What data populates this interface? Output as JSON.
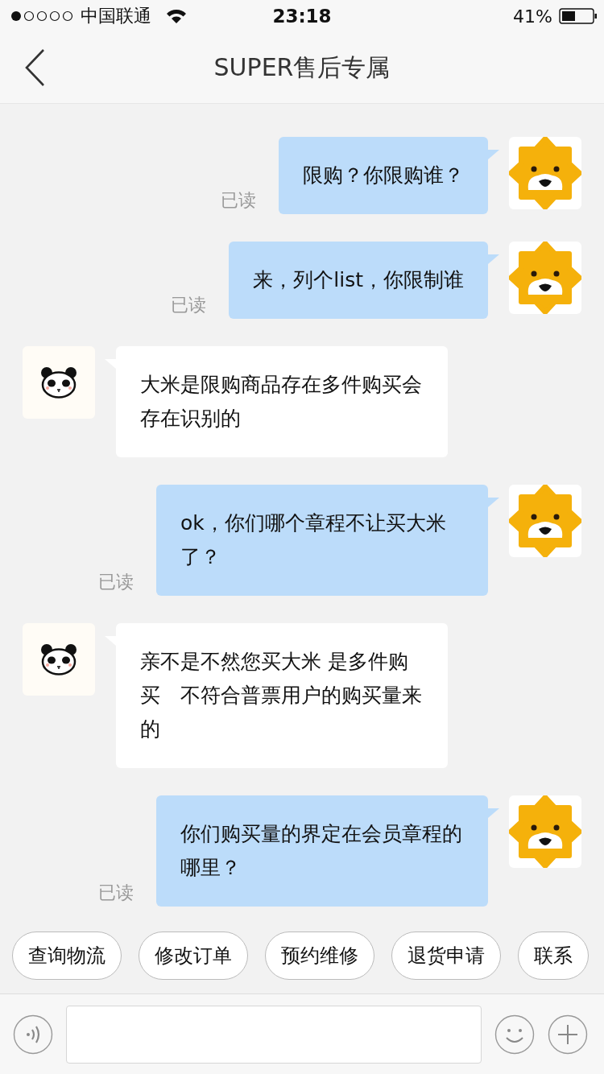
{
  "status_bar": {
    "carrier": "中国联通",
    "time": "23:18",
    "battery": "41%"
  },
  "nav": {
    "title": "SUPER售后专属"
  },
  "messages": [
    {
      "kind": "user",
      "text": "限购？你限购谁？",
      "read_label": "已读"
    },
    {
      "kind": "user",
      "text": "来，列个list，你限制谁",
      "read_label": "已读"
    },
    {
      "kind": "agent",
      "text": "大米是限购商品存在多件购买会存在识别的"
    },
    {
      "kind": "user",
      "text": "ok，你们哪个章程不让买大米了？",
      "read_label": "已读"
    },
    {
      "kind": "agent",
      "text": "亲不是不然您买大米 是多件购买　不符合普票用户的购买量来的"
    },
    {
      "kind": "user",
      "text": "你们购买量的界定在会员章程的哪里？",
      "read_label": "已读"
    }
  ],
  "quick_replies": [
    "查询物流",
    "修改订单",
    "预约维修",
    "退货申请",
    "联系"
  ]
}
